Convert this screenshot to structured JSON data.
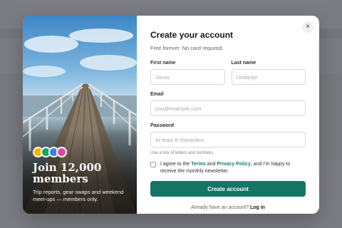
{
  "hero": {
    "avatar_colors": [
      "#f4b400",
      "#12a46a",
      "#3d7ee8",
      "#e0489a"
    ],
    "title": "Join 12,000 members",
    "subtitle": "Trip reports, gear swaps and weekend meet-ups — members only."
  },
  "form": {
    "close_icon": "×",
    "title": "Create your account",
    "subtitle": "Free forever. No card required.",
    "first_name": {
      "label": "First name",
      "value": "",
      "placeholder": "Jonas"
    },
    "last_name": {
      "label": "Last name",
      "value": "",
      "placeholder": "Lindqvist"
    },
    "email": {
      "label": "Email",
      "value": "",
      "placeholder": "you@example.com"
    },
    "password": {
      "label": "Password",
      "value": "",
      "placeholder": "At least 8 characters",
      "hint": "Use a mix of letters and numbers."
    },
    "consent": {
      "prefix": "I agree to the",
      "terms_link": "Terms",
      "and": "and",
      "privacy_link": "Privacy Policy",
      "suffix": ", and I'm happy to receive the monthly newsletter."
    },
    "submit_label": "Create account",
    "footer_text": "Already have an account?",
    "login_link": "Log in"
  },
  "colors": {
    "primary": "#147566",
    "link": "#127a6e"
  }
}
